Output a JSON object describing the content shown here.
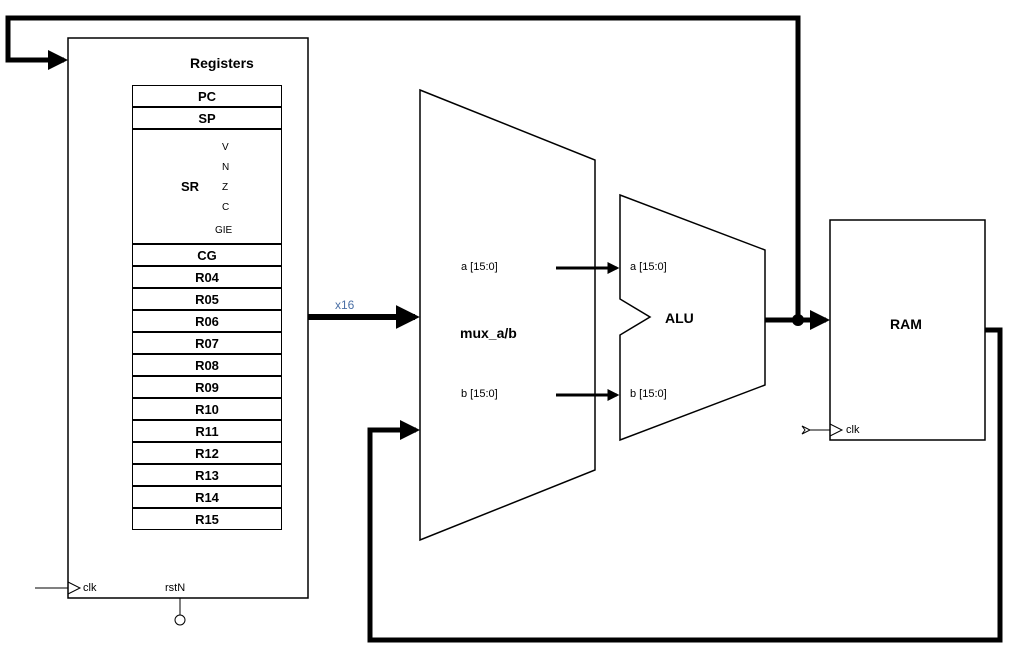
{
  "blocks": {
    "registers": {
      "title": "Registers",
      "rows": [
        "PC",
        "SP",
        "SR",
        "CG",
        "R04",
        "R05",
        "R06",
        "R07",
        "R08",
        "R09",
        "R10",
        "R11",
        "R12",
        "R13",
        "R14",
        "R15"
      ],
      "sr_flags": [
        "V",
        "N",
        "Z",
        "C",
        "GIE"
      ],
      "clk": "clk",
      "rstN": "rstN"
    },
    "mux": {
      "title": "mux_a/b",
      "port_a": "a [15:0]",
      "port_b": "b [15:0]"
    },
    "alu": {
      "title": "ALU",
      "port_a": "a [15:0]",
      "port_b": "b [15:0]"
    },
    "ram": {
      "title": "RAM",
      "clk": "clk"
    },
    "bus_label": "x16"
  }
}
